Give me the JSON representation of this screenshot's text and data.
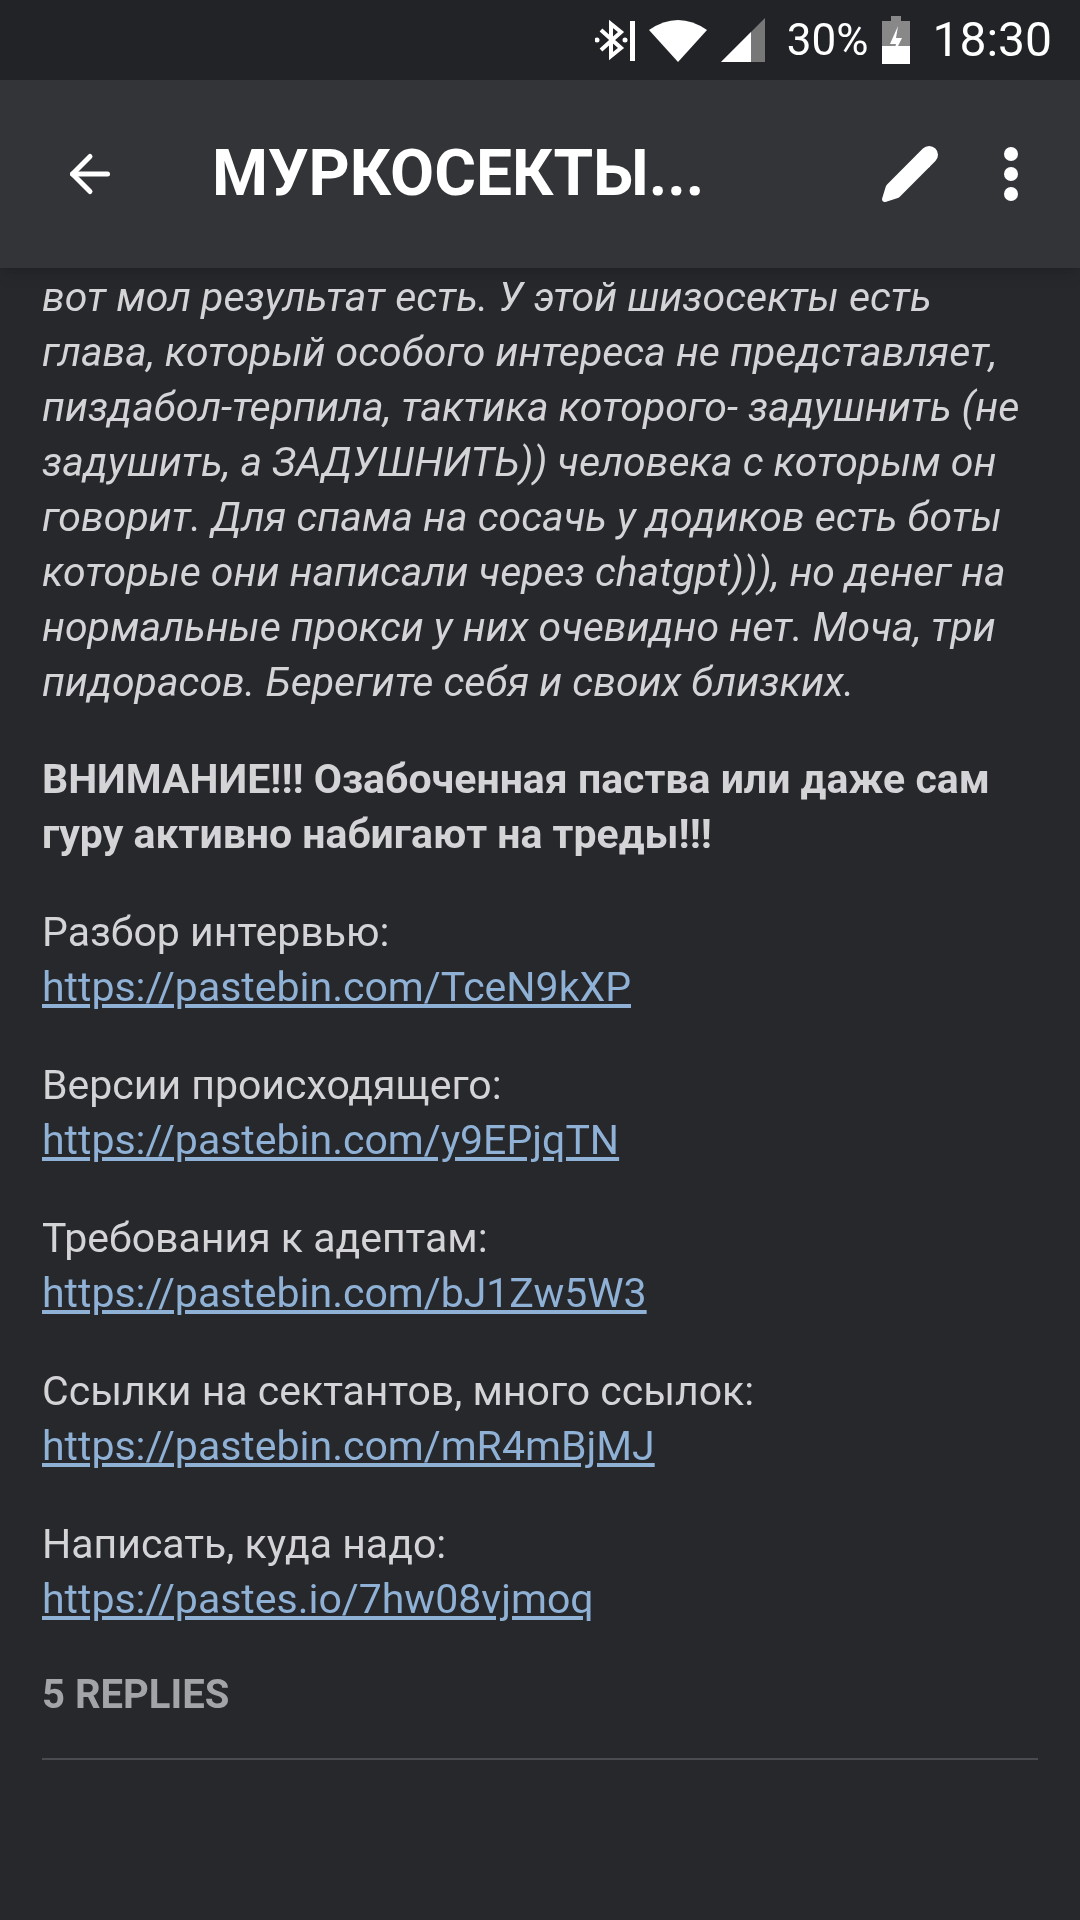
{
  "status_bar": {
    "battery": "30%",
    "time": "18:30"
  },
  "toolbar": {
    "title": "МУРКОСЕКТЫ..."
  },
  "post": {
    "italic_text": "вот мол результат есть. У этой шизосекты есть глава, который особого интереса не представляет, пиздабол-терпила, тактика которого- задушнить (не задушить, а ЗАДУШНИТЬ)) человека с которым он говорит. Для спама на сосачь у додиков есть боты которые они написали через chatgpt))), но денег на нормальные прокси у них очевидно нет. Моча, три пидорасов. Берегите себя и своих близких.",
    "warning": "ВНИМАНИЕ!!! Озабоченная паства или даже сам гуру активно набигают на треды!!!",
    "links": [
      {
        "label": "Разбор интервью:",
        "url": "https://pastebin.com/TceN9kXP"
      },
      {
        "label": "Версии происходящего:",
        "url": "https://pastebin.com/y9EPjqTN"
      },
      {
        "label": "Требования к адептам:",
        "url": "https://pastebin.com/bJ1Zw5W3"
      },
      {
        "label": "Ссылки на сектантов, много ссылок:",
        "url": "https://pastebin.com/mR4mBjMJ"
      },
      {
        "label": "Написать, куда надо:",
        "url": "https://pastes.io/7hw08vjmoq"
      }
    ],
    "replies": "5 REPLIES"
  }
}
